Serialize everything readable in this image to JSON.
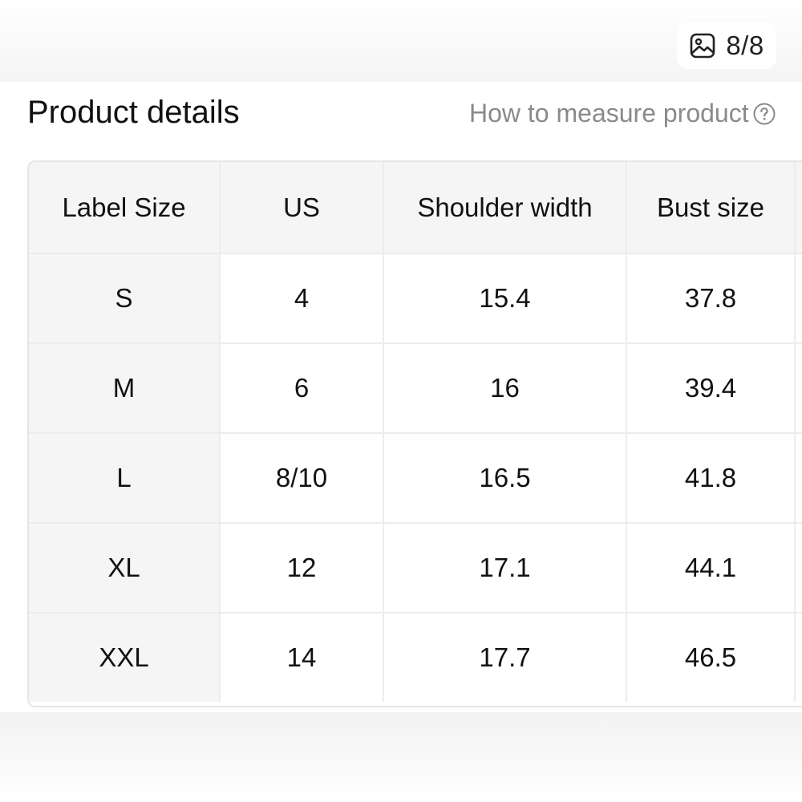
{
  "image_counter": {
    "icon": "image-gallery-icon",
    "text": "8/8"
  },
  "header": {
    "title": "Product details",
    "measure_link": "How to measure product",
    "help_icon": "question-circle-icon"
  },
  "table": {
    "columns": [
      "Label Size",
      "US",
      "Shoulder width",
      "Bust size"
    ],
    "rows": [
      [
        "S",
        "4",
        "15.4",
        "37.8"
      ],
      [
        "M",
        "6",
        "16",
        "39.4"
      ],
      [
        "L",
        "8/10",
        "16.5",
        "41.8"
      ],
      [
        "XL",
        "12",
        "17.1",
        "44.1"
      ],
      [
        "XXL",
        "14",
        "17.7",
        "46.5"
      ]
    ]
  }
}
